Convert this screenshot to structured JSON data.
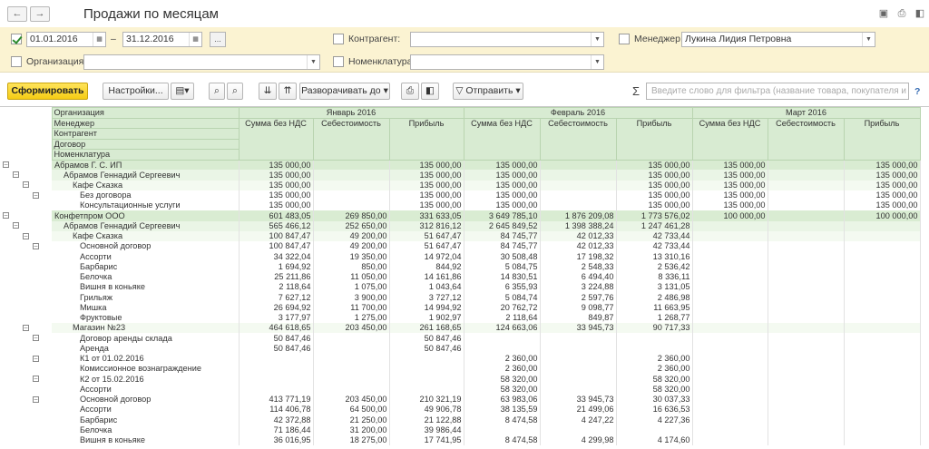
{
  "window": {
    "title": "Продажи по месяцам",
    "back_icon": "←",
    "forward_icon": "→"
  },
  "filters": {
    "period": {
      "checked": true,
      "from": "01.01.2016",
      "to": "31.12.2016",
      "dash": "–",
      "more_label": "..."
    },
    "counterparty": {
      "checked": false,
      "label": "Контрагент:",
      "value": ""
    },
    "manager": {
      "checked": false,
      "label": "Менеджер:",
      "value": "Лукина Лидия Петровна"
    },
    "organization": {
      "checked": false,
      "label": "Организация:",
      "value": ""
    },
    "nomenclature": {
      "checked": false,
      "label": "Номенклатура:",
      "value": ""
    }
  },
  "toolbar": {
    "generate": "Сформировать",
    "settings": "Настройки...",
    "expand": "Разворачивать до",
    "send": "Отправить",
    "sigma": "Σ",
    "search_placeholder": "Введите слово для фильтра (название товара, покупателя и пр.)",
    "help": "?"
  },
  "colors": {
    "accent": "#f5cc15",
    "header_bg": "#d8ebd2",
    "filter_bg": "#fbf3d2"
  },
  "table": {
    "hier_labels": [
      "Организация",
      "Менеджер",
      "Контрагент",
      "Договор",
      "Номенклатура"
    ],
    "months": [
      "Январь 2016",
      "Февраль 2016",
      "Март 2016"
    ],
    "cols": [
      "Сумма без НДС",
      "Себестоимость",
      "Прибыль"
    ],
    "rows": [
      {
        "lvl": 0,
        "name": "Абрамов Г. С. ИП",
        "v": [
          "135 000,00",
          "",
          "135 000,00",
          "135 000,00",
          "",
          "135 000,00",
          "135 000,00",
          "",
          "135 000,00"
        ]
      },
      {
        "lvl": 1,
        "name": "Абрамов Геннадий Сергеевич",
        "v": [
          "135 000,00",
          "",
          "135 000,00",
          "135 000,00",
          "",
          "135 000,00",
          "135 000,00",
          "",
          "135 000,00"
        ]
      },
      {
        "lvl": 2,
        "name": "Кафе Сказка",
        "v": [
          "135 000,00",
          "",
          "135 000,00",
          "135 000,00",
          "",
          "135 000,00",
          "135 000,00",
          "",
          "135 000,00"
        ]
      },
      {
        "lvl": 3,
        "name": "Без договора",
        "v": [
          "135 000,00",
          "",
          "135 000,00",
          "135 000,00",
          "",
          "135 000,00",
          "135 000,00",
          "",
          "135 000,00"
        ]
      },
      {
        "lvl": 4,
        "name": "Консультационные услуги",
        "v": [
          "135 000,00",
          "",
          "135 000,00",
          "135 000,00",
          "",
          "135 000,00",
          "135 000,00",
          "",
          "135 000,00"
        ]
      },
      {
        "lvl": 0,
        "name": "Конфетпром ООО",
        "v": [
          "601 483,05",
          "269 850,00",
          "331 633,05",
          "3 649 785,10",
          "1 876 209,08",
          "1 773 576,02",
          "100 000,00",
          "",
          "100 000,00"
        ]
      },
      {
        "lvl": 1,
        "name": "Абрамов Геннадий Сергеевич",
        "v": [
          "565 466,12",
          "252 650,00",
          "312 816,12",
          "2 645 849,52",
          "1 398 388,24",
          "1 247 461,28",
          "",
          "",
          ""
        ]
      },
      {
        "lvl": 2,
        "name": "Кафе Сказка",
        "v": [
          "100 847,47",
          "49 200,00",
          "51 647,47",
          "84 745,77",
          "42 012,33",
          "42 733,44",
          "",
          "",
          ""
        ]
      },
      {
        "lvl": 3,
        "name": "Основной договор",
        "v": [
          "100 847,47",
          "49 200,00",
          "51 647,47",
          "84 745,77",
          "42 012,33",
          "42 733,44",
          "",
          "",
          ""
        ]
      },
      {
        "lvl": 4,
        "name": "Ассорти",
        "v": [
          "34 322,04",
          "19 350,00",
          "14 972,04",
          "30 508,48",
          "17 198,32",
          "13 310,16",
          "",
          "",
          ""
        ]
      },
      {
        "lvl": 4,
        "name": "Барбарис",
        "v": [
          "1 694,92",
          "850,00",
          "844,92",
          "5 084,75",
          "2 548,33",
          "2 536,42",
          "",
          "",
          ""
        ]
      },
      {
        "lvl": 4,
        "name": "Белочка",
        "v": [
          "25 211,86",
          "11 050,00",
          "14 161,86",
          "14 830,51",
          "6 494,40",
          "8 336,11",
          "",
          "",
          ""
        ]
      },
      {
        "lvl": 4,
        "name": "Вишня в коньяке",
        "v": [
          "2 118,64",
          "1 075,00",
          "1 043,64",
          "6 355,93",
          "3 224,88",
          "3 131,05",
          "",
          "",
          ""
        ]
      },
      {
        "lvl": 4,
        "name": "Грильяж",
        "v": [
          "7 627,12",
          "3 900,00",
          "3 727,12",
          "5 084,74",
          "2 597,76",
          "2 486,98",
          "",
          "",
          ""
        ]
      },
      {
        "lvl": 4,
        "name": "Мишка",
        "v": [
          "26 694,92",
          "11 700,00",
          "14 994,92",
          "20 762,72",
          "9 098,77",
          "11 663,95",
          "",
          "",
          ""
        ]
      },
      {
        "lvl": 4,
        "name": "Фруктовые",
        "v": [
          "3 177,97",
          "1 275,00",
          "1 902,97",
          "2 118,64",
          "849,87",
          "1 268,77",
          "",
          "",
          ""
        ]
      },
      {
        "lvl": 2,
        "name": "Магазин №23",
        "v": [
          "464 618,65",
          "203 450,00",
          "261 168,65",
          "124 663,06",
          "33 945,73",
          "90 717,33",
          "",
          "",
          ""
        ]
      },
      {
        "lvl": 3,
        "name": "Договор аренды склада",
        "v": [
          "50 847,46",
          "",
          "50 847,46",
          "",
          "",
          "",
          "",
          "",
          ""
        ]
      },
      {
        "lvl": 4,
        "name": "Аренда",
        "v": [
          "50 847,46",
          "",
          "50 847,46",
          "",
          "",
          "",
          "",
          "",
          ""
        ]
      },
      {
        "lvl": 3,
        "name": "К1 от 01.02.2016",
        "v": [
          "",
          "",
          "",
          "2 360,00",
          "",
          "2 360,00",
          "",
          "",
          ""
        ]
      },
      {
        "lvl": 4,
        "name": "Комиссионное вознаграждение",
        "v": [
          "",
          "",
          "",
          "2 360,00",
          "",
          "2 360,00",
          "",
          "",
          ""
        ]
      },
      {
        "lvl": 3,
        "name": "К2 от 15.02.2016",
        "v": [
          "",
          "",
          "",
          "58 320,00",
          "",
          "58 320,00",
          "",
          "",
          ""
        ]
      },
      {
        "lvl": 4,
        "name": "Ассорти",
        "v": [
          "",
          "",
          "",
          "58 320,00",
          "",
          "58 320,00",
          "",
          "",
          ""
        ]
      },
      {
        "lvl": 3,
        "name": "Основной договор",
        "v": [
          "413 771,19",
          "203 450,00",
          "210 321,19",
          "63 983,06",
          "33 945,73",
          "30 037,33",
          "",
          "",
          ""
        ]
      },
      {
        "lvl": 4,
        "name": "Ассорти",
        "v": [
          "114 406,78",
          "64 500,00",
          "49 906,78",
          "38 135,59",
          "21 499,06",
          "16 636,53",
          "",
          "",
          ""
        ]
      },
      {
        "lvl": 4,
        "name": "Барбарис",
        "v": [
          "42 372,88",
          "21 250,00",
          "21 122,88",
          "8 474,58",
          "4 247,22",
          "4 227,36",
          "",
          "",
          ""
        ]
      },
      {
        "lvl": 4,
        "name": "Белочка",
        "v": [
          "71 186,44",
          "31 200,00",
          "39 986,44",
          "",
          "",
          "",
          "",
          "",
          ""
        ]
      },
      {
        "lvl": 4,
        "name": "Вишня в коньяке",
        "v": [
          "36 016,95",
          "18 275,00",
          "17 741,95",
          "8 474,58",
          "4 299,98",
          "4 174,60",
          "",
          "",
          ""
        ]
      }
    ]
  }
}
